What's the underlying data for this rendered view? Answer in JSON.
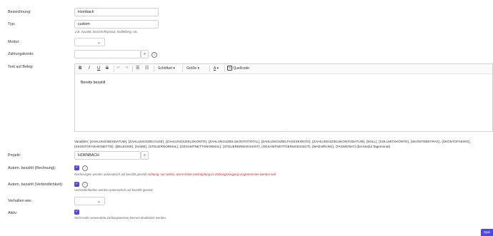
{
  "fields": {
    "bezeichnung": {
      "label": "Bezeichnung:",
      "value": "Hornbach"
    },
    "typ": {
      "label": "Typ:",
      "value": "custom",
      "hint": "z.B. novalet, lastschriftspezial, heidelberg, etc."
    },
    "modul": {
      "label": "Modul:",
      "value": ""
    },
    "zahlungskonto": {
      "label": "Zahlungskonto:",
      "value": ""
    },
    "text": {
      "label": "Text auf Beleg:"
    },
    "projekt": {
      "label": "Projekt:",
      "value": "HORNBACH"
    },
    "autom_rechnung": {
      "label": "Autom. bezahlt (Rechnung):",
      "hint": "Rechnungen werden automatisch auf bezahlt gesetzt ",
      "warning": "Achtung: nur setzen, wenn keine Verknüpfung im Zahlungseingang vorgenommen werden soll."
    },
    "autom_verbindlichkeit": {
      "label": "Autom. bezahlt (Verbindlichkeit):",
      "hint": "Verbindlichkeiten werden automatisch auf bezahlt gesetzt."
    },
    "verhalten": {
      "label": "Verhalten wie:",
      "value": ""
    },
    "aktiv": {
      "label": "Aktiv:",
      "hint": "Nicht mehr verwendete Zahlungsweisen können deaktiviert werden."
    }
  },
  "editor": {
    "toolbar": {
      "bold": "B",
      "italic": "I",
      "underline": "U",
      "strike": "S̶",
      "font_label": "Schriftart",
      "size_label": "Größe",
      "color": "A",
      "source_label": "Quellcode"
    },
    "content": "Bereits bezahlt"
  },
  "variables_text": "Variablen: {ZAHLUNGSBISDATUM}, {ZAHLUNGSZIELTAGE}, {ZAHLUNGSZIELSKONTO}, {ZAHLUNGSZIELSKONTOTOTAL}, {ZAHLUNGSZIELTAGESKONTO}, {ZAHLUNGSZIELSKONTODATUM}, {SOLL}, {SOLLMITSKONTO}, {SKONTOBETRAG}, {SKONTOFAEHIG}, {SKONTOFAEHIGNETTO}, {BELEGNR}, {NAME}, {STEUERNORMAL}, {GESAMTNETTONORMAL}, {STEUERERMAESSIGT}, {GESAMTNETTOERMAESSIGT}, {WAEHRUNG}, {TAGMONAT} (bei Modul Tagemonat)",
  "checks": {
    "autom_rechnung": true,
    "autom_verbindlichkeit": true,
    "aktiv": true
  },
  "save_label": "Spei",
  "colors": {
    "accent": "#4f46e5",
    "warning": "#c62828"
  }
}
